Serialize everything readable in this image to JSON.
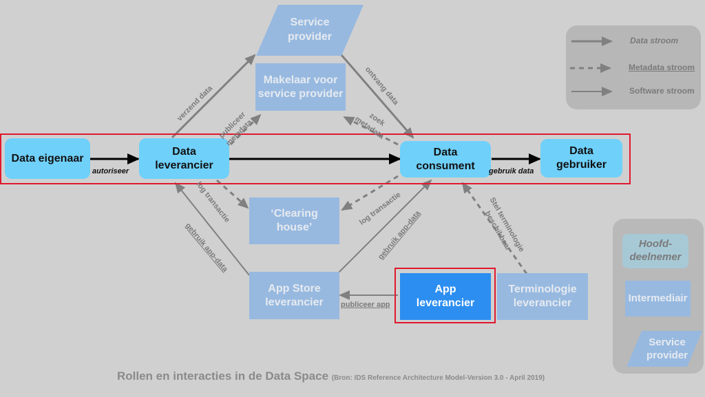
{
  "diagram": {
    "caption": "Rollen en interacties in de Data Space",
    "source": "(Bron: IDS Reference Architecture Model-Version 3.0 - April 2019)",
    "colors": {
      "background": "#d0d0d0",
      "main_participant": "#6fd0fa",
      "intermediary": "#97b9e0",
      "app_provider": "#2c8ef0",
      "highlight": "#e0182d",
      "arrow_gray": "#808080",
      "arrow_black": "#000000"
    },
    "nodes": {
      "data_eigenaar": "Data eigenaar",
      "data_leverancier": "Data leverancier",
      "data_consument": "Data consument",
      "data_gebruiker": "Data gebruiker",
      "service_provider": "Service provider",
      "makelaar": "Makelaar voor service provider",
      "clearing_house": "‘Clearing house’",
      "app_store": "App Store leverancier",
      "app_leverancier": "App leverancier",
      "terminologie": "Terminologie leverancier"
    },
    "edges": {
      "autoriseer": "autoriseer",
      "gebruik_data": "gebruik data",
      "verzend_data": "verzend data",
      "ontvang_data": "ontvang data",
      "publiceer_metadata_1": "publiceer",
      "publiceer_metadata_2": "metadata",
      "zoek_metadata_1": "zoek",
      "zoek_metadata_2": "metadata",
      "log_transactie_left": "log transactie",
      "log_transactie_right": "log transactie",
      "gebruik_app_data_left": "gebruik app-data",
      "gebruik_app_data_right": "gebruik app-data",
      "publiceer_app": "publiceer app",
      "stel_terminologie_1": "Stel terminologie",
      "stel_terminologie_2": "beschikbaar"
    },
    "legend_flows": {
      "data": "Data stroom",
      "metadata": "Metadata stroom",
      "software": "Software stroom"
    },
    "legend_roles": {
      "hoofd": "Hoofd-deelnemer",
      "intermediair": "Intermediair",
      "service_provider": "Service provider"
    }
  }
}
